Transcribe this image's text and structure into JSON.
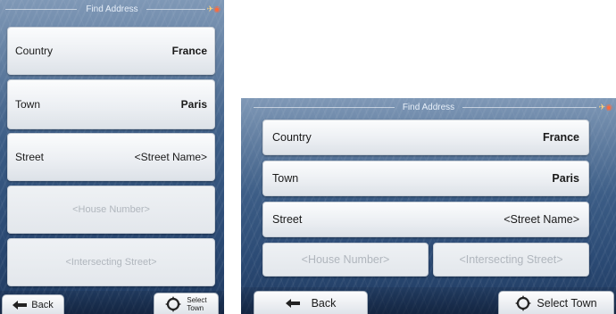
{
  "title": "Find Address",
  "fields": [
    {
      "label": "Country",
      "value": "France"
    },
    {
      "label": "Town",
      "value": "Paris"
    },
    {
      "label": "Street",
      "value": "<Street Name>"
    },
    {
      "label": "<House Number>"
    },
    {
      "label": "<Intersecting Street>"
    }
  ],
  "buttons": {
    "back": "Back",
    "select_town": "Select Town",
    "select_town_line1": "Select",
    "select_town_line2": "Town"
  },
  "icons": {
    "back": "left-arrow-icon",
    "select": "crosshair-target-icon",
    "status": "gps-satellite-icon"
  },
  "colors": {
    "background_top": "#7f98b6",
    "background_bottom": "#1f3a60",
    "row_face": "#eceff3",
    "disabled_text": "#b0b6bd"
  }
}
